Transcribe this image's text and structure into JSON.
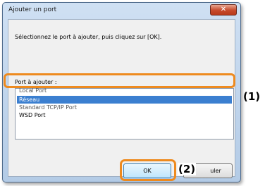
{
  "dialog": {
    "title": "Ajouter un port",
    "close_label": "✕",
    "instruction": "Sélectionnez le port à ajouter, puis cliquez sur [OK].",
    "list_label": "Port à ajouter :",
    "ports": [
      {
        "label": "Local Port"
      },
      {
        "label": "Réseau"
      },
      {
        "label": "Standard TCP/IP Port"
      },
      {
        "label": "WSD Port"
      }
    ],
    "ok_label": "OK",
    "cancel_label": "uler"
  },
  "annotations": {
    "callout_1": "(1)",
    "callout_2": "(2)"
  },
  "colors": {
    "highlight": "#ee8a1e",
    "selection": "#3b7fd0",
    "close_button": "#c74a2c"
  }
}
